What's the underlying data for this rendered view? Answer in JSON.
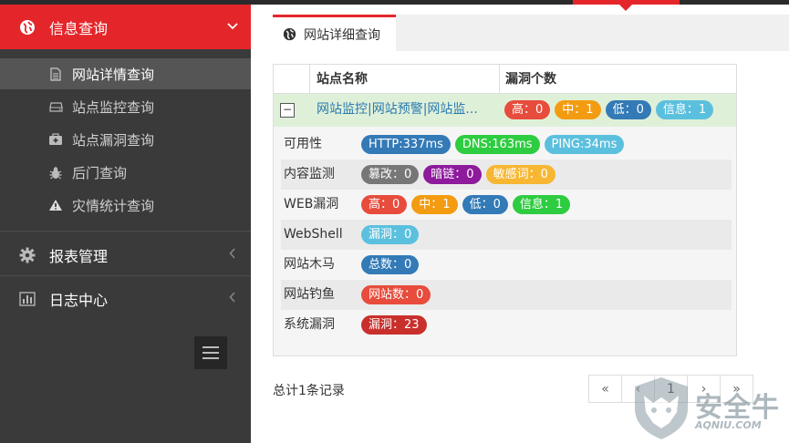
{
  "sidebar": {
    "groups": [
      {
        "label": "信息查询",
        "icon": "globe-icon",
        "arrow": "chevron-down-icon"
      },
      {
        "label": "报表管理",
        "icon": "gear-icon",
        "arrow": "chevron-left-icon"
      },
      {
        "label": "日志中心",
        "icon": "bar-chart-icon",
        "arrow": "chevron-left-icon"
      }
    ],
    "items": [
      {
        "label": "网站详情查询",
        "icon": "document-icon"
      },
      {
        "label": "站点监控查询",
        "icon": "hdd-icon"
      },
      {
        "label": "站点漏洞查询",
        "icon": "medkit-icon"
      },
      {
        "label": "后门查询",
        "icon": "bug-icon"
      },
      {
        "label": "灾情统计查询",
        "icon": "warning-icon"
      }
    ]
  },
  "tab": {
    "label": "网站详细查询",
    "icon": "globe-icon"
  },
  "table": {
    "headers": [
      "站点名称",
      "漏洞个数"
    ],
    "row": {
      "toggle": "−",
      "site": "网站监控|网站预警|网站监...",
      "badges": [
        {
          "text": "高：0",
          "color": "#e74c3c"
        },
        {
          "text": "中：1",
          "color": "#f39c12"
        },
        {
          "text": "低：0",
          "color": "#337ab7"
        },
        {
          "text": "信息：1",
          "color": "#5bc0de"
        }
      ]
    },
    "details": [
      {
        "label": "可用性",
        "badges": [
          {
            "text": "HTTP:337ms",
            "color": "#337ab7"
          },
          {
            "text": "DNS:163ms",
            "color": "#2ecc40"
          },
          {
            "text": "PING:34ms",
            "color": "#5bc0de"
          }
        ]
      },
      {
        "label": "内容监测",
        "badges": [
          {
            "text": "篡改：0",
            "color": "#777777"
          },
          {
            "text": "暗链：0",
            "color": "#8e1a9c"
          },
          {
            "text": "敏感词：0",
            "color": "#f7b733"
          }
        ]
      },
      {
        "label": "WEB漏洞",
        "badges": [
          {
            "text": "高：0",
            "color": "#e74c3c"
          },
          {
            "text": "中：1",
            "color": "#f39c12"
          },
          {
            "text": "低：0",
            "color": "#337ab7"
          },
          {
            "text": "信息：1",
            "color": "#2ecc40"
          }
        ]
      },
      {
        "label": "WebShell",
        "badges": [
          {
            "text": "漏洞：0",
            "color": "#5bc0de"
          }
        ]
      },
      {
        "label": "网站木马",
        "badges": [
          {
            "text": "总数：0",
            "color": "#337ab7"
          }
        ]
      },
      {
        "label": "网站钓鱼",
        "badges": [
          {
            "text": "网站数：0",
            "color": "#e74c3c"
          }
        ]
      },
      {
        "label": "系统漏洞",
        "badges": [
          {
            "text": "漏洞：23",
            "color": "#c9302c"
          }
        ]
      }
    ]
  },
  "footer": {
    "total": "总计1条记录"
  },
  "pagination": {
    "first": "«",
    "prev": "‹",
    "current": "1",
    "next": "›",
    "last": "»"
  },
  "watermark": {
    "text": "安全牛",
    "sub": "AQNIU.COM"
  },
  "colors": {
    "accent": "#e4262b",
    "sidebar_bg": "#3a3a3a",
    "row_highlight": "#dff0d8"
  }
}
